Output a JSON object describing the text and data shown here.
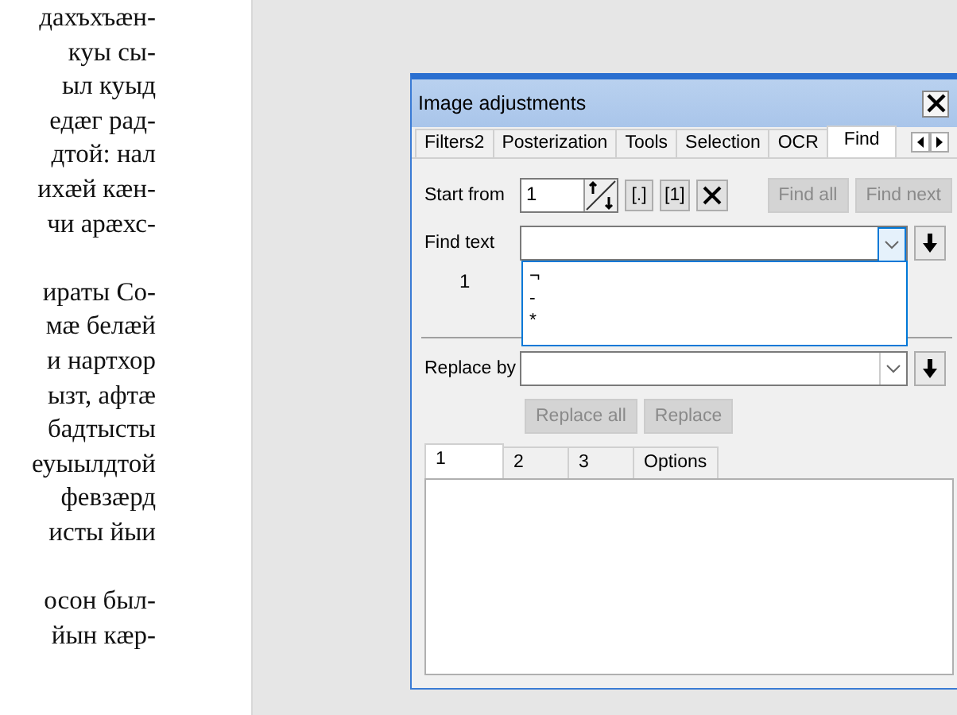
{
  "document": {
    "paragraphs": [
      {
        "lines": [
          "дахъхъæн-",
          "куы сы-",
          "ыл куыд",
          "едæг рад-",
          "дтой: нал",
          "ихæй кæн-",
          "чи арæхс-"
        ]
      },
      {
        "lines": [
          "ираты Со-",
          "мæ белæй",
          "и нартхор",
          "ызт, афтæ",
          "бадтысты",
          "еуыылдтой",
          "февзæрд",
          "исты йыи"
        ]
      },
      {
        "lines": [
          "осон был-",
          "йын кæр-"
        ]
      }
    ]
  },
  "dialog": {
    "title": "Image adjustments",
    "tabs": [
      {
        "label": "Filters2",
        "selected": false
      },
      {
        "label": "Posterization",
        "selected": false
      },
      {
        "label": "Tools",
        "selected": false
      },
      {
        "label": "Selection",
        "selected": false
      },
      {
        "label": "OCR",
        "selected": false
      },
      {
        "label": "Find",
        "selected": true
      }
    ],
    "start_from": {
      "label": "Start from",
      "value": "1"
    },
    "tool_buttons": [
      {
        "kind": "text",
        "label": "[.]"
      },
      {
        "kind": "text",
        "label": "[1]"
      },
      {
        "kind": "clear"
      }
    ],
    "action_buttons": [
      {
        "label": "Find all",
        "disabled": true
      },
      {
        "label": "Find next",
        "disabled": true
      }
    ],
    "find_text": {
      "label": "Find text",
      "expanded": true,
      "options": [
        {
          "label": "¬"
        },
        {
          "label": "-"
        },
        {
          "label": "*"
        }
      ]
    },
    "match_row": {
      "label": "1"
    },
    "replace_by": {
      "label": "Replace by",
      "expanded": false
    },
    "replace_buttons": [
      {
        "label": "Replace all",
        "disabled": true
      },
      {
        "label": "Replace",
        "disabled": true
      }
    ],
    "result_tabs": [
      {
        "label": "1",
        "selected": true
      },
      {
        "label": "2",
        "selected": false
      },
      {
        "label": "3",
        "selected": false
      },
      {
        "label": "Options",
        "selected": false
      }
    ]
  }
}
